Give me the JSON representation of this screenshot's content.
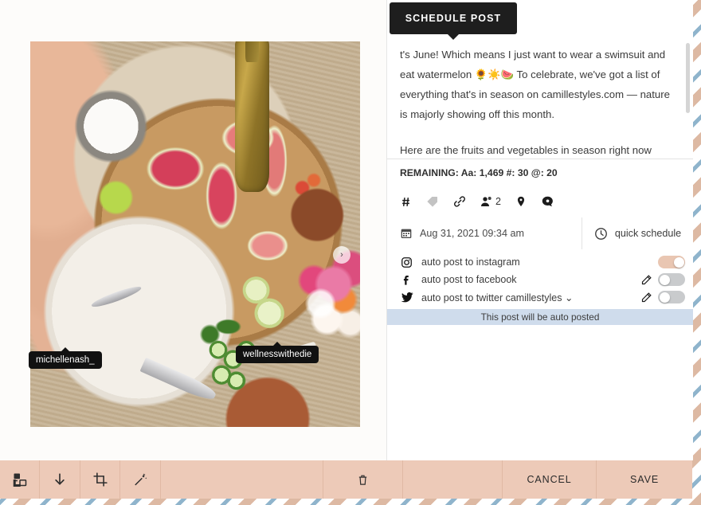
{
  "tooltip": {
    "label": "SCHEDULE POST"
  },
  "caption": {
    "paragraphs": [
      "t's June! Which means I just want to wear a swimsuit and eat watermelon 🌻☀️🍉 To celebrate, we've got a list of everything that's in season on camillestyles.com — nature is majorly showing off this month.",
      "Here are the fruits and vegetables in season right now (Save"
    ]
  },
  "remaining": {
    "text": "REMAINING: Aa: 1,469   #: 30   @: 20"
  },
  "icon_row": {
    "items": [
      {
        "name": "hashtag-icon",
        "glyph": "#"
      },
      {
        "name": "tag-icon",
        "glyph": "tag"
      },
      {
        "name": "link-icon",
        "glyph": "link"
      },
      {
        "name": "people-tag-icon",
        "glyph": "person",
        "count": "2"
      },
      {
        "name": "location-icon",
        "glyph": "pin"
      },
      {
        "name": "comment-icon",
        "glyph": "comment"
      }
    ]
  },
  "schedule": {
    "datetime": "Aug 31, 2021 09:34 am",
    "quick_label": "quick schedule"
  },
  "auto_post": [
    {
      "network": "instagram",
      "label": "auto post to instagram",
      "enabled": true,
      "has_edit": false
    },
    {
      "network": "facebook",
      "label": "auto post to facebook",
      "enabled": false,
      "has_edit": true
    },
    {
      "network": "twitter",
      "label": "auto post to twitter camillestyles",
      "enabled": false,
      "has_edit": true,
      "caret": "⌄"
    }
  ],
  "notice": {
    "text": "This post will be auto posted"
  },
  "photo": {
    "tags": [
      {
        "name": "michellenash_"
      },
      {
        "name": "wellnesswithedie"
      }
    ],
    "next_arrow": "›"
  },
  "bottom_bar": {
    "tools": [
      {
        "name": "duplicate-icon"
      },
      {
        "name": "download-icon"
      },
      {
        "name": "crop-icon"
      },
      {
        "name": "magic-wand-icon"
      }
    ],
    "trash": {
      "name": "trash-icon"
    },
    "cancel_label": "CANCEL",
    "save_label": "SAVE"
  },
  "colors": {
    "accent_peach": "#edcab8",
    "toggle_on": "#e9c6b2",
    "notice_bg": "#cfdcec",
    "tooltip_bg": "#1e1e1e"
  }
}
